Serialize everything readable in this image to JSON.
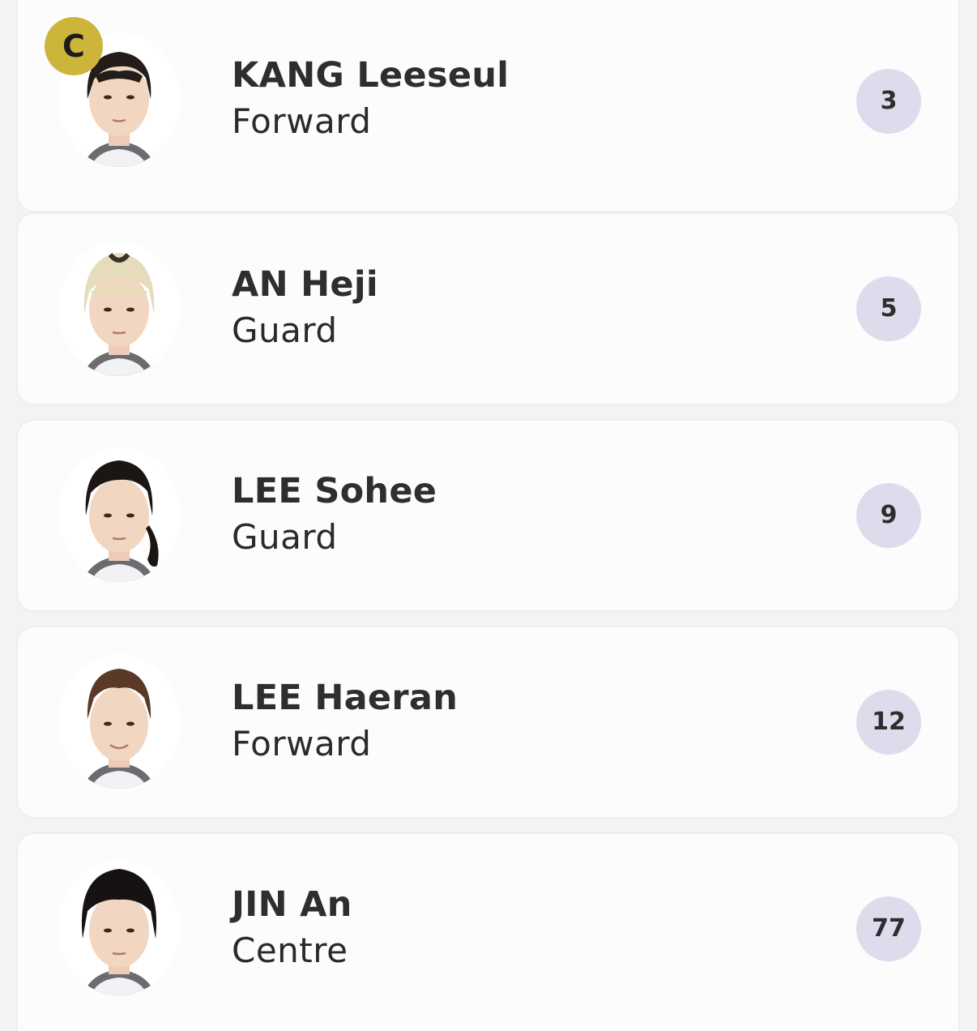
{
  "roster": {
    "captain_badge": "C",
    "players": [
      {
        "name": "KANG Leeseul",
        "position": "Forward",
        "number": "3",
        "captain": true,
        "hair": "dark-bangs"
      },
      {
        "name": "AN Heji",
        "position": "Guard",
        "number": "5",
        "captain": false,
        "hair": "blonde"
      },
      {
        "name": "LEE Sohee",
        "position": "Guard",
        "number": "9",
        "captain": false,
        "hair": "dark-ponytail"
      },
      {
        "name": "LEE Haeran",
        "position": "Forward",
        "number": "12",
        "captain": false,
        "hair": "brown-pulled-back"
      },
      {
        "name": "JIN An",
        "position": "Centre",
        "number": "77",
        "captain": false,
        "hair": "dark-short"
      }
    ]
  },
  "colors": {
    "captain_badge": "#cdb43a",
    "number_badge": "#dedbec",
    "card_background": "#fcfcfd",
    "page_background": "#f3f3f5"
  }
}
